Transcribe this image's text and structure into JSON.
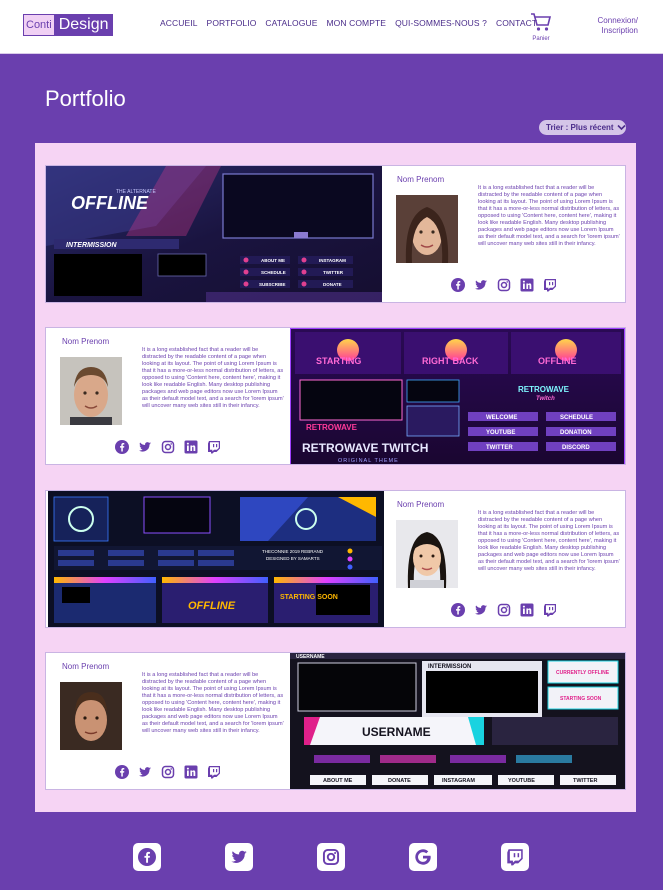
{
  "header": {
    "logo_part1": "Conti",
    "logo_part2": "Design",
    "nav": [
      "ACCUEIL",
      "PORTFOLIO",
      "CATALOGUE",
      "MON COMPTE",
      "QUI-SOMMES-NOUS ?",
      "CONTACT"
    ],
    "cart_label": "Panier",
    "login_line1": "Connexion/",
    "login_line2": "Inscription"
  },
  "page_title": "Portfolio",
  "sort_label": "Trier : Plus récent",
  "cards": [
    {
      "name": "Nom Prenom",
      "description": "It is a long established fact that a reader will be distracted by the readable content of a page when looking at its layout. The point of using Lorem Ipsum is that it has a more-or-less normal distribution of letters, as opposed to using 'Content here, content here', making it look like readable English. Many desktop publishing packages and web page editors now use Lorem Ipsum as their default model text, and a search for 'lorem ipsum' will uncover many web sites still in their infancy.",
      "overlay": {
        "tag": "THE ALTERNATE",
        "big_title": "OFFLINE",
        "sub_title": "INTERMISSION",
        "buttons": [
          "ABOUT ME",
          "INSTAGRAM",
          "SCHEDULE",
          "TWITTER",
          "SUBSCRIBE",
          "DONATE"
        ]
      }
    },
    {
      "name": "Nom Prenom",
      "description": "It is a long established fact that a reader will be distracted by the readable content of a page when looking at its layout. The point of using Lorem Ipsum is that it has a more-or-less normal distribution of letters, as opposed to using 'Content here, content here', making it look like readable English. Many desktop publishing packages and web page editors now use Lorem Ipsum as their default model text, and a search for 'lorem ipsum' will uncover many web sites still in their infancy.",
      "overlay": {
        "panels": [
          "STARTING",
          "RIGHT BACK",
          "OFFLINE"
        ],
        "brand": "RETROWAVE",
        "brand_sub": "Twitch",
        "buttons": [
          "WELCOME",
          "SCHEDULE",
          "YOUTUBE",
          "DONATION",
          "TWITTER",
          "DISCORD"
        ],
        "footer": "RETROWAVE TWITCH",
        "footer_sub": "ORIGINAL THEME"
      }
    },
    {
      "name": "Nom Prenom",
      "description": "It is a long established fact that a reader will be distracted by the readable content of a page when looking at its layout. The point of using Lorem Ipsum is that it has a more-or-less normal distribution of letters, as opposed to using 'Content here, content here', making it look like readable English. Many desktop publishing packages and web page editors now use Lorem Ipsum as their default model text, and a search for 'lorem ipsum' will uncover many web sites still in their infancy.",
      "overlay": {
        "panels": [
          "OFFLINE",
          "STARTING SOON"
        ],
        "credit_line1": "THECONNIE 2019 REBRAND",
        "credit_line2": "DESIGNED BY SAMARTS"
      }
    },
    {
      "name": "Nom Prenom",
      "description": "It is a long established fact that a reader will be distracted by the readable content of a page when looking at its layout. The point of using Lorem Ipsum is that it has a more-or-less normal distribution of letters, as opposed to using 'Content here, content here', making it look like readable English. Many desktop publishing packages and web page editors now use Lorem Ipsum as their default model text, and a search for 'lorem ipsum' will uncover many web sites still in their infancy.",
      "overlay": {
        "top_label": "USERNAME",
        "intermission": "INTERMISSION",
        "side_panels": [
          "CURRENTLY OFFLINE",
          "STARTING SOON"
        ],
        "banner": "USERNAME",
        "buttons": [
          "ABOUT ME",
          "DONATE",
          "INSTAGRAM",
          "YOUTUBE",
          "TWITTER"
        ]
      }
    }
  ],
  "social_icons": [
    "facebook-icon",
    "twitter-icon",
    "instagram-icon",
    "linkedin-icon",
    "twitch-icon"
  ],
  "footer_icons": [
    "facebook-icon",
    "twitter-icon",
    "instagram-icon",
    "google-icon",
    "twitch-icon"
  ],
  "colors": {
    "brand": "#6a3fae",
    "panel": "#f6d4f4",
    "white": "#ffffff"
  }
}
